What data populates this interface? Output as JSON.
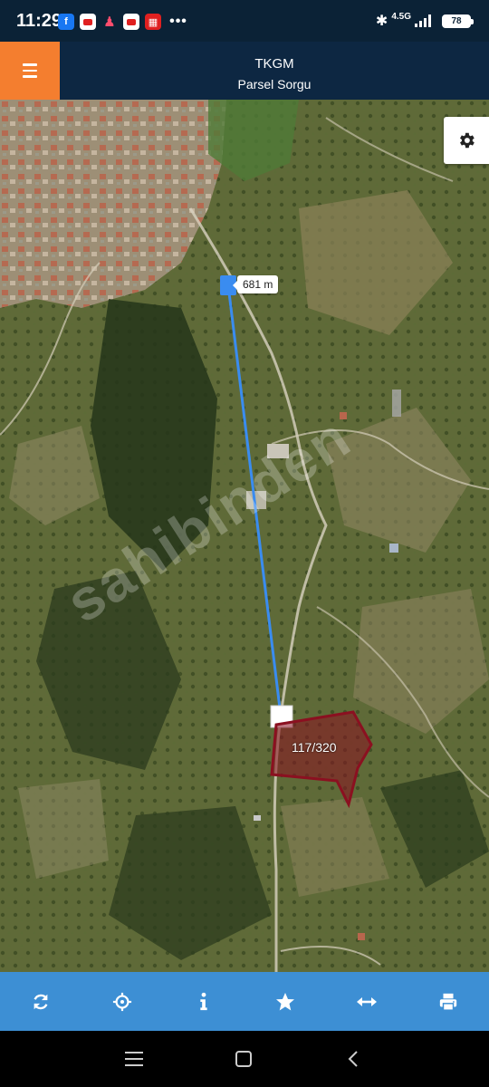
{
  "status_bar": {
    "time": "11:29",
    "network": "4.5G",
    "battery": "78",
    "notification_icons": [
      "facebook-icon",
      "youtube-icon",
      "person-icon",
      "youtube-icon",
      "app-icon",
      "more-dots-icon"
    ]
  },
  "header": {
    "title": "TKGM",
    "subtitle": "Parsel Sorgu",
    "accent_color": "#f47e2f",
    "background_color": "#0d2742"
  },
  "map": {
    "distance_label": "681 m",
    "parcel_label": "117/320",
    "watermark": "sahibinden",
    "measure_line_color": "#3a8cf0",
    "parcel_color": "#8b1020"
  },
  "toolbar": {
    "background_color": "#3d8fd4",
    "buttons": [
      "refresh-icon",
      "locate-icon",
      "info-icon",
      "favorite-star-icon",
      "measure-icon",
      "print-icon"
    ]
  },
  "navbar": {
    "buttons": [
      "recent-apps-icon",
      "home-icon",
      "back-icon"
    ]
  }
}
